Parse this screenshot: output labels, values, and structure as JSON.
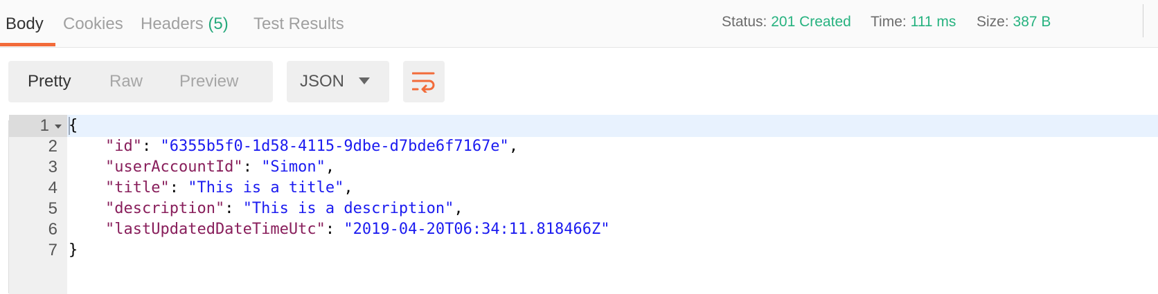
{
  "tabs": [
    {
      "label": "Body"
    },
    {
      "label": "Cookies"
    },
    {
      "label": "Headers",
      "count": "(5)"
    },
    {
      "label": "Test Results"
    }
  ],
  "status": {
    "label": "Status:",
    "value": "201 Created"
  },
  "time": {
    "label": "Time:",
    "value": "111 ms"
  },
  "size": {
    "label": "Size:",
    "value": "387 B"
  },
  "view_modes": [
    "Pretty",
    "Raw",
    "Preview"
  ],
  "format": {
    "selected": "JSON"
  },
  "colors": {
    "accent": "#f26b3a",
    "success": "#26b27f",
    "json_key": "#881e5b",
    "json_string": "#1b1bf0"
  },
  "icons": {
    "wrap": "wrap-lines-icon",
    "format_dropdown": "chevron-down-icon",
    "fold": "fold-caret-icon"
  },
  "code": {
    "line_numbers": [
      "1",
      "2",
      "3",
      "4",
      "5",
      "6",
      "7"
    ],
    "open_brace": "{",
    "close_brace": "}",
    "fields": [
      {
        "key": "\"id\"",
        "value": "\"6355b5f0-1d58-4115-9dbe-d7bde6f7167e\"",
        "trail": ","
      },
      {
        "key": "\"userAccountId\"",
        "value": "\"Simon\"",
        "trail": ","
      },
      {
        "key": "\"title\"",
        "value": "\"This is a title\"",
        "trail": ","
      },
      {
        "key": "\"description\"",
        "value": "\"This is a description\"",
        "trail": ","
      },
      {
        "key": "\"lastUpdatedDateTimeUtc\"",
        "value": "\"2019-04-20T06:34:11.818466Z\"",
        "trail": ""
      }
    ],
    "separator": ": "
  }
}
